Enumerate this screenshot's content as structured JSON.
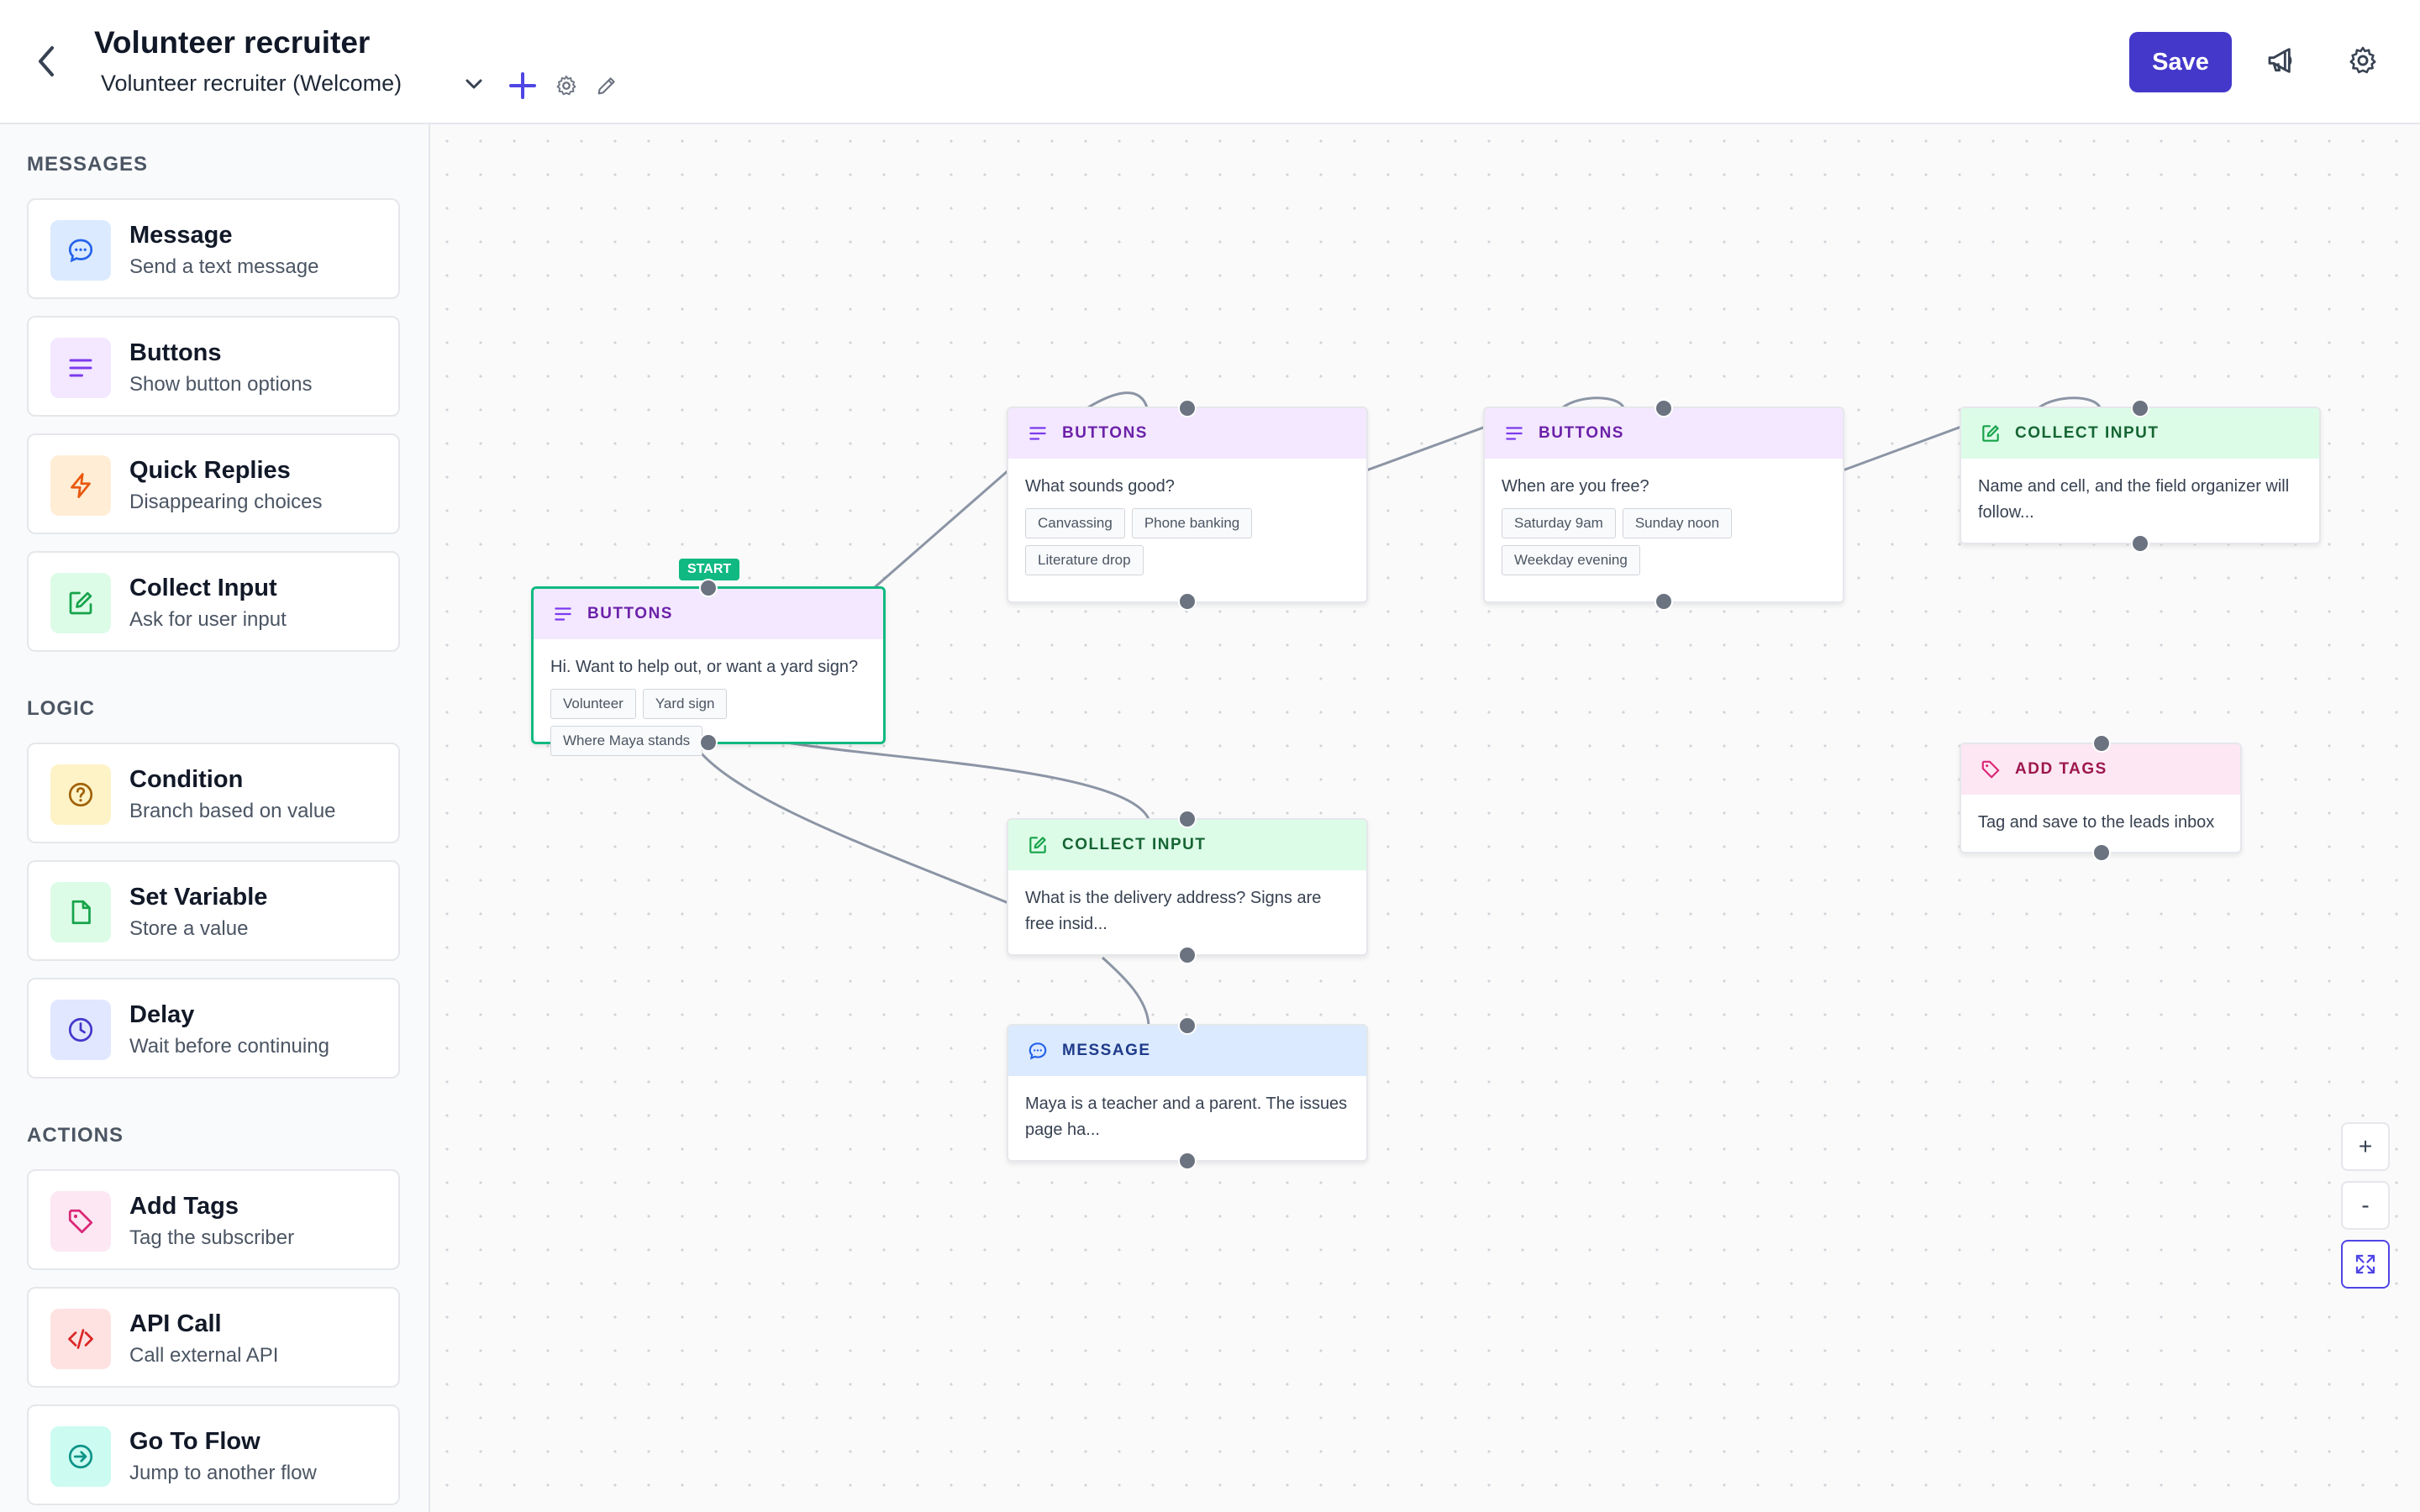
{
  "header": {
    "title": "Volunteer recruiter",
    "flow_selected": "Volunteer recruiter (Welcome)",
    "save_label": "Save"
  },
  "sidebar": {
    "sections": [
      {
        "title": "MESSAGES",
        "items": [
          {
            "label": "Message",
            "desc": "Send a text message",
            "icon": "chat-bubble-icon",
            "color": "#2563eb"
          },
          {
            "label": "Buttons",
            "desc": "Show button options",
            "icon": "menu-lines-icon",
            "color": "#7c3aed"
          },
          {
            "label": "Quick Replies",
            "desc": "Disappearing choices",
            "icon": "lightning-icon",
            "color": "#ea580c"
          },
          {
            "label": "Collect Input",
            "desc": "Ask for user input",
            "icon": "edit-icon",
            "color": "#16a34a"
          }
        ]
      },
      {
        "title": "LOGIC",
        "items": [
          {
            "label": "Condition",
            "desc": "Branch based on value",
            "icon": "question-circle-icon",
            "color": "#ca8a04"
          },
          {
            "label": "Set Variable",
            "desc": "Store a value",
            "icon": "document-icon",
            "color": "#16a34a"
          },
          {
            "label": "Delay",
            "desc": "Wait before continuing",
            "icon": "clock-icon",
            "color": "#4338ca"
          }
        ]
      },
      {
        "title": "ACTIONS",
        "items": [
          {
            "label": "Add Tags",
            "desc": "Tag the subscriber",
            "icon": "tag-icon",
            "color": "#db2777"
          },
          {
            "label": "API Call",
            "desc": "Call external API",
            "icon": "code-icon",
            "color": "#dc2626"
          },
          {
            "label": "Go To Flow",
            "desc": "Jump to another flow",
            "icon": "arrow-circle-icon",
            "color": "#0d9488"
          }
        ]
      }
    ]
  },
  "canvas": {
    "start_badge": "START",
    "nodes": [
      {
        "type": "BUTTONS",
        "text": "Hi. Want to help out, or want a yard sign?",
        "chips": [
          "Volunteer",
          "Yard sign",
          "Where Maya stands"
        ]
      },
      {
        "type": "BUTTONS",
        "text": "What sounds good?",
        "chips": [
          "Canvassing",
          "Phone banking",
          "Literature drop"
        ]
      },
      {
        "type": "BUTTONS",
        "text": "When are you free?",
        "chips": [
          "Saturday 9am",
          "Sunday noon",
          "Weekday evening"
        ]
      },
      {
        "type": "COLLECT INPUT",
        "text": "Name and cell, and the field organizer will follow..."
      },
      {
        "type": "ADD TAGS",
        "text": "Tag and save to the leads inbox"
      },
      {
        "type": "COLLECT INPUT",
        "text": "What is the delivery address? Signs are free insid..."
      },
      {
        "type": "MESSAGE",
        "text": "Maya is a teacher and a parent. The issues page ha..."
      }
    ]
  },
  "zoom_controls": {
    "zoom_in": "+",
    "zoom_out": "-"
  },
  "colors": {
    "accent": "#4338ca",
    "start": "#10b981"
  }
}
